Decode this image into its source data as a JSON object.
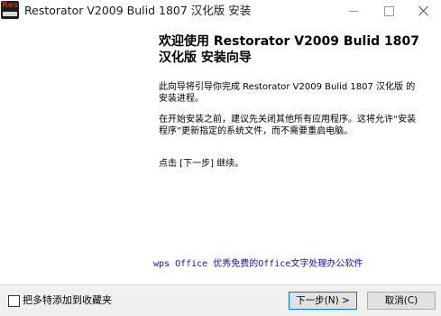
{
  "window": {
    "title": "Restorator V2009 Bulid 1807 汉化版 安装",
    "icon_label": "Res"
  },
  "main": {
    "heading": "欢迎使用 Restorator V2009 Bulid 1807 汉化版 安装向导",
    "paragraphs": [
      "此向导将引导你完成 Restorator V2009 Bulid 1807 汉化版 的安装进程。",
      "在开始安装之前，建议先关闭其他所有应用程序。这将允许“安装程序”更新指定的系统文件，而不需要重启电脑。",
      "点击 [下一步] 继续。"
    ],
    "ad_link": "wps Office 优秀免费的Office文字处理办公软件"
  },
  "footer": {
    "checkbox_label": "把多特添加到收藏夹",
    "checkbox_checked": false,
    "next_label": "下一步(N) >",
    "cancel_label": "取消(C)"
  },
  "colors": {
    "link": "#1212c8",
    "focus_border": "#0078d7",
    "footer_bg": "#f0f0f0"
  },
  "icons": [
    "app-icon",
    "minimize-icon",
    "maximize-icon",
    "close-icon"
  ]
}
